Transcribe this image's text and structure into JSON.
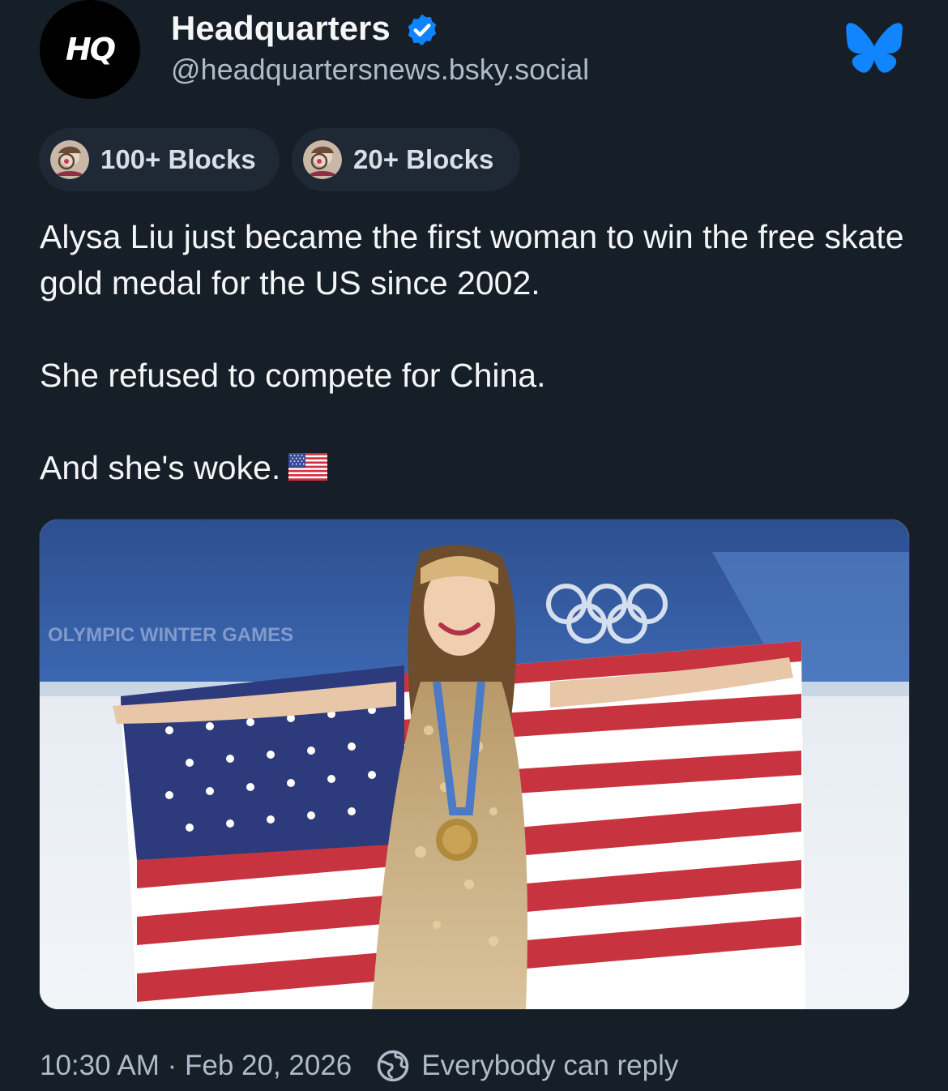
{
  "post": {
    "author": {
      "avatar_text": "HQ",
      "display_name": "Headquarters",
      "handle": "@headquartersnews.bsky.social",
      "verified": true
    },
    "labels": [
      {
        "label": "100+ Blocks"
      },
      {
        "label": "20+ Blocks"
      }
    ],
    "text": [
      "Alysa Liu just became the first woman to win the free skate gold medal for the US since 2002.",
      "She refused to compete for China.",
      "And she's woke."
    ],
    "emoji": "us-flag-emoji",
    "image": {
      "description_icon": "photo",
      "banner_text": "OLYMPIC WINTER GAMES"
    },
    "timestamp": "10:30 AM · Feb 20, 2026",
    "reply_setting": "Everybody can reply"
  },
  "colors": {
    "background": "#161e27",
    "chip_background": "#1e2935",
    "secondary_text": "#aebbc9",
    "verified_blue": "#1083fe",
    "bluesky_blue": "#1185fe"
  },
  "icons": [
    "verified-icon",
    "bluesky-butterfly-icon",
    "reply-globe-icon",
    "label-avatar-icon"
  ]
}
